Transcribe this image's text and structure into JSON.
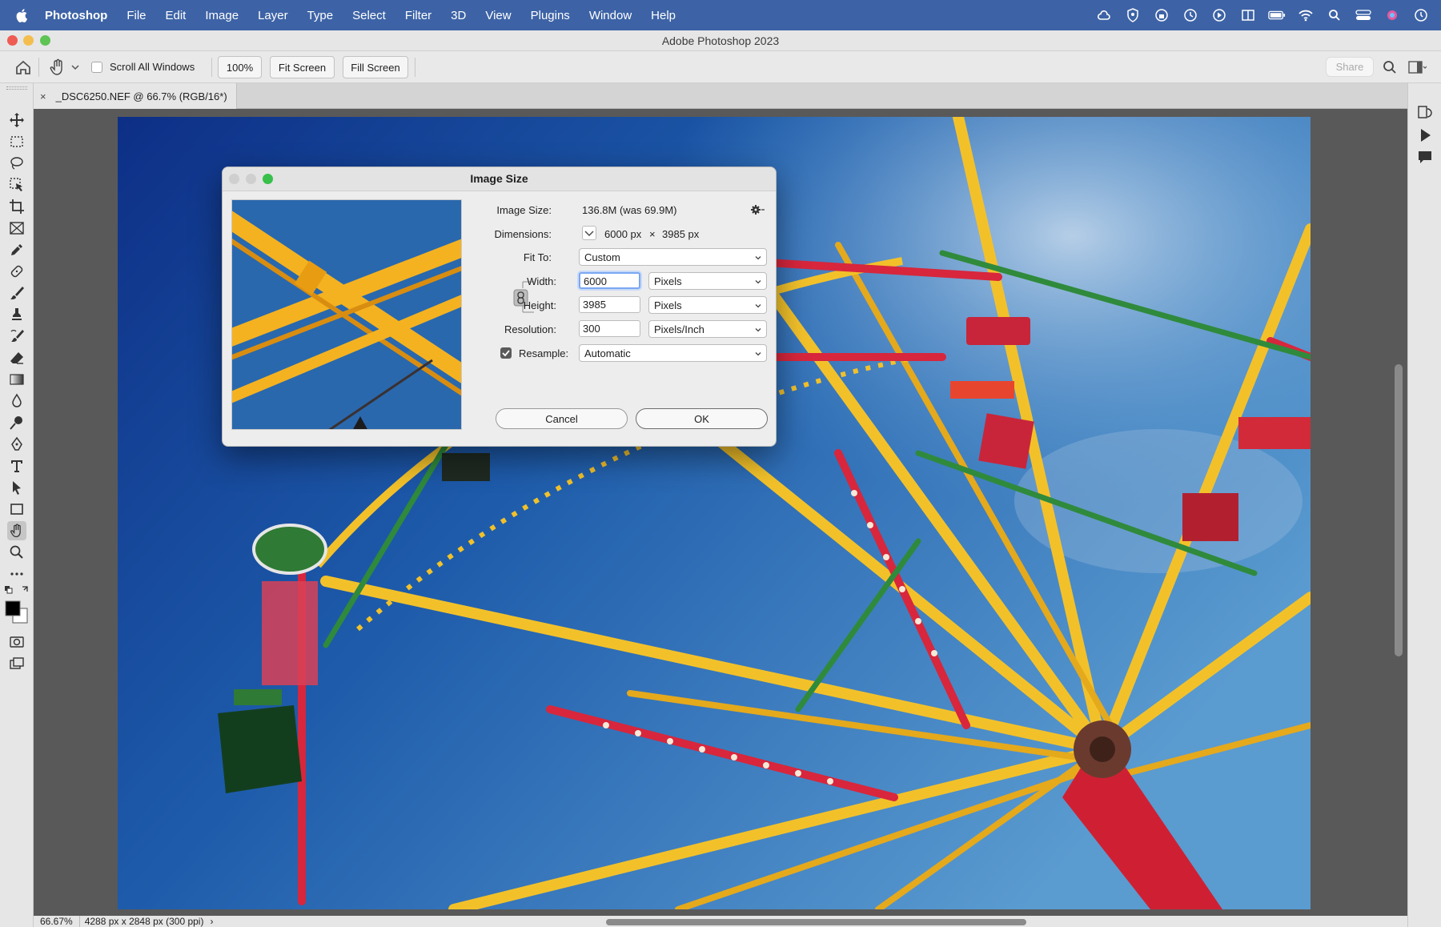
{
  "menubar": {
    "app_name": "Photoshop",
    "items": [
      "File",
      "Edit",
      "Image",
      "Layer",
      "Type",
      "Select",
      "Filter",
      "3D",
      "View",
      "Plugins",
      "Window",
      "Help"
    ]
  },
  "window": {
    "title": "Adobe Photoshop 2023"
  },
  "options_bar": {
    "scroll_all_windows_label": "Scroll All Windows",
    "zoom_100_label": "100%",
    "fit_screen_label": "Fit Screen",
    "fill_screen_label": "Fill Screen",
    "share_label": "Share"
  },
  "document": {
    "tab_title": "_DSC6250.NEF @ 66.7% (RGB/16*)",
    "close_glyph": "×"
  },
  "status_bar": {
    "zoom": "66.67%",
    "info": "4288 px x 2848 px (300 ppi)",
    "more": "›"
  },
  "dialog": {
    "title": "Image Size",
    "image_size_label": "Image Size:",
    "image_size_value": "136.8M (was 69.9M)",
    "dimensions_label": "Dimensions:",
    "dimensions_width": "6000 px",
    "dimensions_times": "×",
    "dimensions_height": "3985 px",
    "fit_to_label": "Fit To:",
    "fit_to_value": "Custom",
    "width_label": "Width:",
    "width_value": "6000",
    "width_unit": "Pixels",
    "height_label": "Height:",
    "height_value": "3985",
    "height_unit": "Pixels",
    "resolution_label": "Resolution:",
    "resolution_value": "300",
    "resolution_unit": "Pixels/Inch",
    "resample_label": "Resample:",
    "resample_checked": true,
    "resample_value": "Automatic",
    "cancel_label": "Cancel",
    "ok_label": "OK"
  },
  "colors": {
    "menubar_bg": "#3d63a6",
    "sky_top": "#0f3a8f",
    "sky_bottom": "#3f86c4",
    "wheel_yellow": "#f2c12a",
    "wheel_red": "#d8263c",
    "wheel_green": "#2f8a3c",
    "focus_ring": "#7ba7f2"
  }
}
